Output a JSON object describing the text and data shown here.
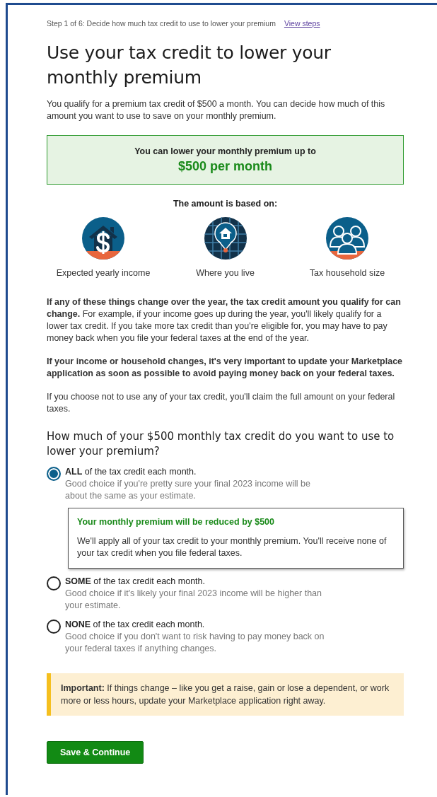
{
  "step": {
    "text": "Step 1 of 6: Decide how much tax credit to use to lower your premium",
    "link": "View steps"
  },
  "title": "Use your tax credit to lower your monthly premium",
  "intro": "You qualify for a premium tax credit of $500 a month. You can decide how much of this amount you want to use to save on your monthly premium.",
  "highlight": {
    "label": "You can lower your monthly premium up to",
    "amount": "$500 per month"
  },
  "factors": {
    "heading": "The amount is based on:",
    "items": [
      {
        "kind": "income",
        "label": "Expected yearly income"
      },
      {
        "kind": "location",
        "label": "Where you live"
      },
      {
        "kind": "household",
        "label": "Tax household size"
      }
    ]
  },
  "paragraphs": [
    "**If any of these things change over the year, the tax credit amount you qualify for can change.** For example, if your income goes up during the year, you'll likely qualify for a lower tax credit. If you take more tax credit than you're eligible for, you may have to pay money back when you file your federal taxes at the end of the year.",
    "**If your income or household changes, it's very important to update your Marketplace application as soon as possible to avoid paying money back on your federal taxes.**",
    "If you choose not to use any of your tax credit, you'll claim the full amount on your federal taxes."
  ],
  "question": "How much of your $500 monthly tax credit do you want to use to lower your premium?",
  "options": [
    {
      "label": "**ALL** of the tax credit each month.",
      "hint": "Good choice if you're pretty sure your final 2023 income will be about the same as your estimate.",
      "selected": true,
      "detail": {
        "title": "Your monthly premium will be reduced by $500",
        "text": "We'll apply all of your tax credit to your monthly premium. You'll receive none of your tax credit when you file federal taxes."
      }
    },
    {
      "label": "**SOME** of the tax credit each month.",
      "hint": "Good choice if it's likely your final 2023 income will be higher than your estimate.",
      "selected": false
    },
    {
      "label": "**NONE** of the tax credit each month.",
      "hint": "Good choice if you don't want to risk having to pay money back on your federal taxes if anything changes.",
      "selected": false
    }
  ],
  "alert": "**Important:** If things change – like you get a raise, gain or lose a dependent, or work more or less hours, update your Marketplace application right away.",
  "button": "Save & Continue"
}
